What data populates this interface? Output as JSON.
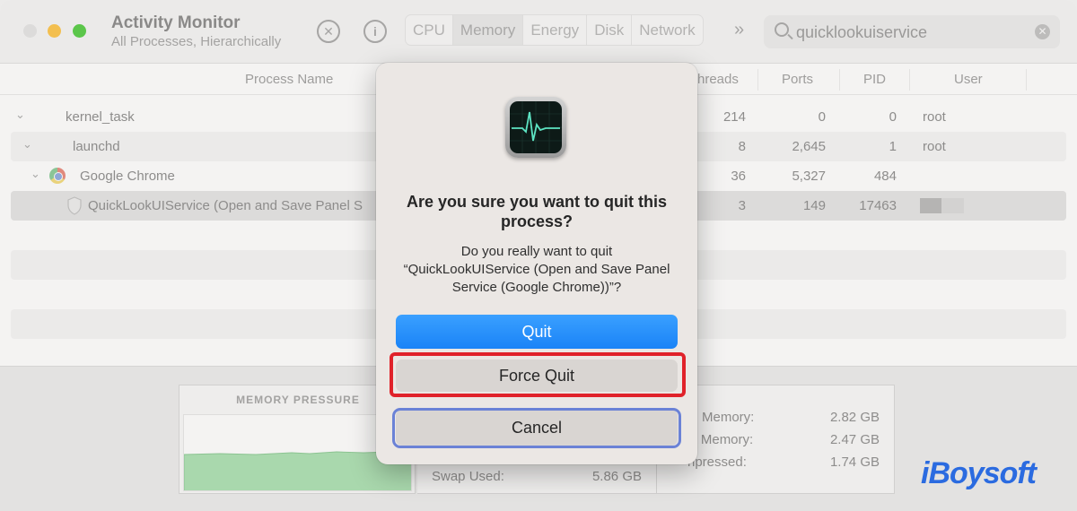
{
  "window": {
    "title": "Activity Monitor",
    "subtitle": "All Processes, Hierarchically"
  },
  "toolbar": {
    "tabs": [
      "CPU",
      "Memory",
      "Energy",
      "Disk",
      "Network"
    ],
    "active_tab": "Memory",
    "more": "»",
    "search_value": "quicklookuiservice"
  },
  "table": {
    "headers": {
      "process_name": "Process Name",
      "threads": "hreads",
      "ports": "Ports",
      "pid": "PID",
      "user": "User"
    },
    "rows": [
      {
        "name": "kernel_task",
        "threads": "214",
        "ports": "0",
        "pid": "0",
        "user": "root"
      },
      {
        "name": "launchd",
        "threads": "8",
        "ports": "2,645",
        "pid": "1",
        "user": "root"
      },
      {
        "name": "Google Chrome",
        "threads": "36",
        "ports": "5,327",
        "pid": "484",
        "user": ""
      },
      {
        "name": "QuickLookUIService (Open and Save Panel S",
        "threads": "3",
        "ports": "149",
        "pid": "17463",
        "user": ""
      }
    ]
  },
  "memory": {
    "pressure_title": "MEMORY PRESSURE",
    "swap_label": "Swap Used:",
    "swap_value": "5.86 GB",
    "stats": [
      {
        "label": "Memory:",
        "value": "2.82 GB"
      },
      {
        "label": "ed Memory:",
        "value": "2.47 GB"
      },
      {
        "label": "npressed:",
        "value": "1.74 GB"
      }
    ]
  },
  "dialog": {
    "title": "Are you sure you want to quit this process?",
    "message": "Do you really want to quit “QuickLookUIService (Open and Save Panel Service (Google Chrome))”?",
    "quit_label": "Quit",
    "force_quit_label": "Force Quit",
    "cancel_label": "Cancel"
  },
  "watermark": "iBoysoft",
  "colors": {
    "accent_blue": "#1a83f7",
    "highlight_red": "#e0222a",
    "highlight_blue": "#6b82d6",
    "pressure_green": "#a9d8ad",
    "logo_blue": "#2b6be0"
  }
}
